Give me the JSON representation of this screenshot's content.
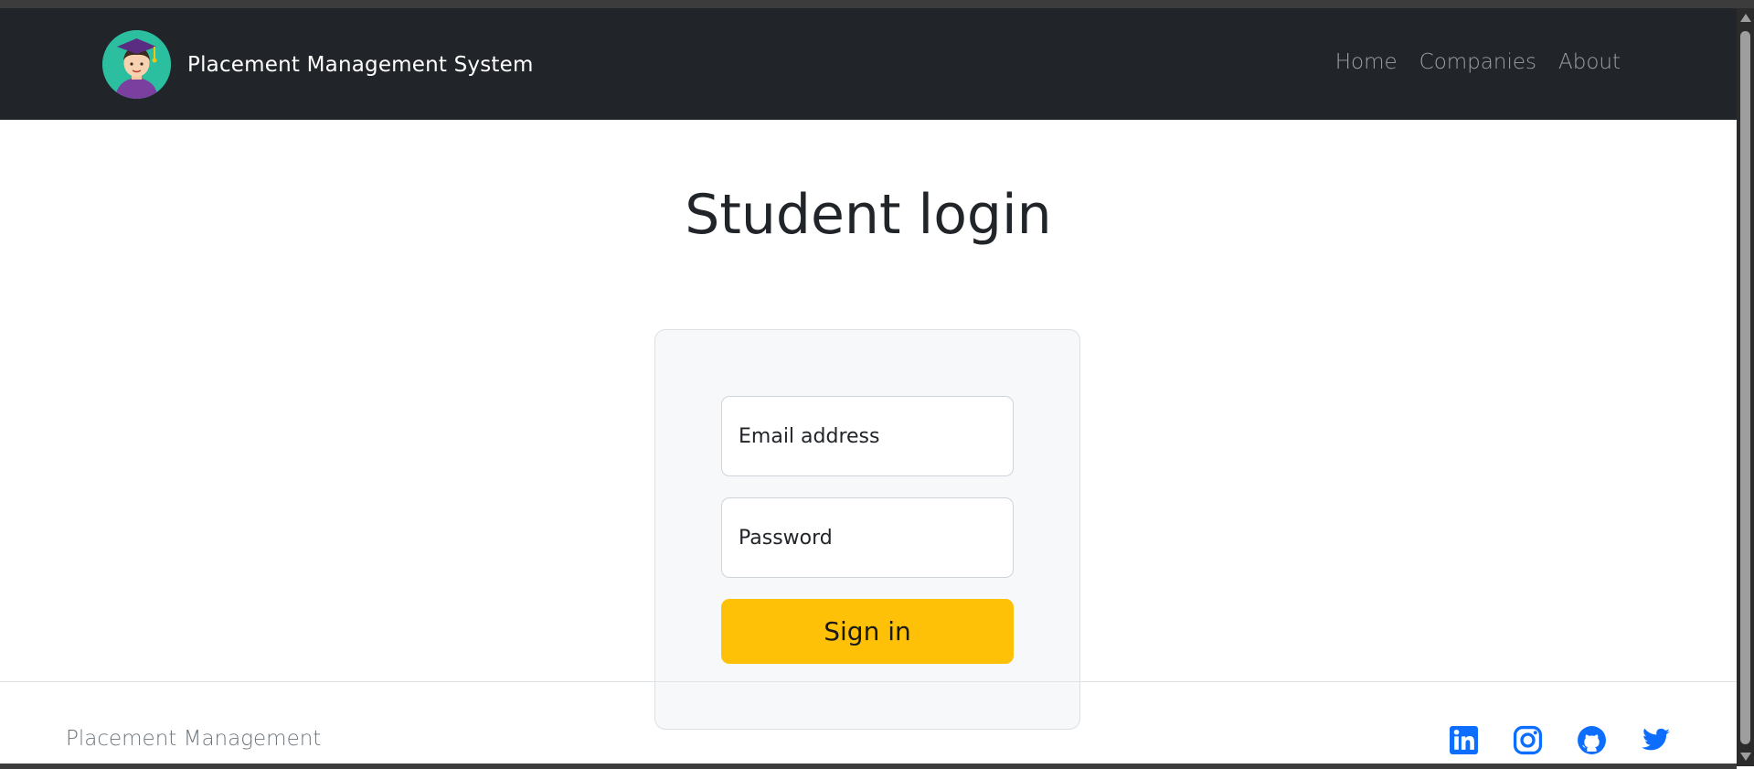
{
  "navbar": {
    "brand_title": "Placement Management System",
    "links": [
      "Home",
      "Companies",
      "About"
    ]
  },
  "main": {
    "title": "Student login",
    "form": {
      "email_placeholder": "Email address",
      "password_placeholder": "Password",
      "submit_label": "Sign in"
    }
  },
  "footer": {
    "brand": "Placement Management",
    "social_icons": [
      "linkedin-icon",
      "instagram-icon",
      "github-icon",
      "twitter-icon"
    ]
  },
  "colors": {
    "navbar_bg": "#212529",
    "accent": "#ffc107",
    "social": "#0d6efd"
  }
}
